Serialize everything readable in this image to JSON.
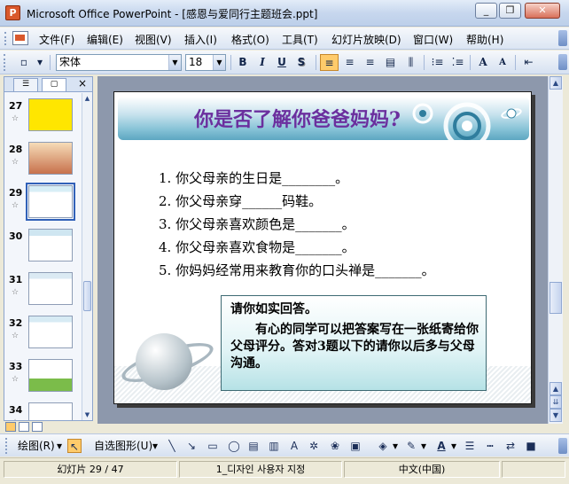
{
  "window": {
    "title": "Microsoft Office PowerPoint - [感恩与爱同行主题班会.ppt]",
    "app_icon": "P",
    "minimize_icon": "_",
    "restore_icon": "❐",
    "close_icon": "✕"
  },
  "menu": {
    "items": [
      "文件(F)",
      "编辑(E)",
      "视图(V)",
      "插入(I)",
      "格式(O)",
      "工具(T)",
      "幻灯片放映(D)",
      "窗口(W)",
      "帮助(H)"
    ]
  },
  "format_toolbar": {
    "font": "宋体",
    "size": "18",
    "bold": "B",
    "italic": "I",
    "underline": "U",
    "shadow": "S",
    "increase_font": "A",
    "decrease_font": "A"
  },
  "panel": {
    "tab_outline_icon": "outline-tab-icon",
    "tab_slides_icon": "slides-tab-icon",
    "close": "×",
    "thumbnails": [
      {
        "num": "27",
        "star": "☆"
      },
      {
        "num": "28",
        "star": "☆"
      },
      {
        "num": "29",
        "star": "☆",
        "selected": true
      },
      {
        "num": "30",
        "star": ""
      },
      {
        "num": "31",
        "star": "☆"
      },
      {
        "num": "32",
        "star": "☆"
      },
      {
        "num": "33",
        "star": "☆"
      },
      {
        "num": "34",
        "star": "☆"
      }
    ]
  },
  "slide": {
    "title": "你是否了解你爸爸妈妈?",
    "questions": [
      "1. 你父母亲的生日是________。",
      "2. 你父母亲穿______码鞋。",
      "3. 你父母亲喜欢颜色是_______。",
      "4. 你父母亲喜欢食物是_______。",
      "5. 你妈妈经常用来教育你的口头禅是_______。"
    ],
    "note_title": "请你如实回答。",
    "note_body": "有心的同学可以把答案写在一张纸寄给你父母评分。答对3题以下的请你以后多与父母沟通。",
    "colors": {
      "title": "#6b2f9e",
      "banner": "#5da6c1"
    }
  },
  "drawing_toolbar": {
    "draw_label": "绘图(R)",
    "autoshapes_label": "自选图形(U)"
  },
  "status": {
    "slide": "幻灯片 29 / 47",
    "design": "1_디자인 사용자 지정",
    "language": "中文(中国)"
  }
}
